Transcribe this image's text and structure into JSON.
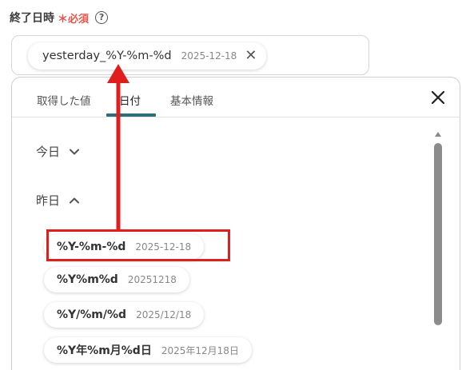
{
  "field": {
    "label": "終了日時",
    "required": "＊必須",
    "help": "?"
  },
  "input": {
    "chip_key": "yesterday_%Y-%m-%d",
    "chip_value": "2025-12-18",
    "remove": "✕"
  },
  "tabs": [
    {
      "label": "取得した値"
    },
    {
      "label": "日付"
    },
    {
      "label": "基本情報"
    }
  ],
  "sections": {
    "today": "今日",
    "yesterday": "昨日"
  },
  "formats": [
    {
      "key": "%Y-%m-%d",
      "value": "2025-12-18"
    },
    {
      "key": "%Y%m%d",
      "value": "20251218"
    },
    {
      "key": "%Y/%m/%d",
      "value": "2025/12/18"
    },
    {
      "key": "%Y年%m月%d日",
      "value": "2025年12月18日"
    }
  ],
  "colors": {
    "accent": "#2e6d7a",
    "required": "#e8534a",
    "annotation": "#e01e1e"
  }
}
